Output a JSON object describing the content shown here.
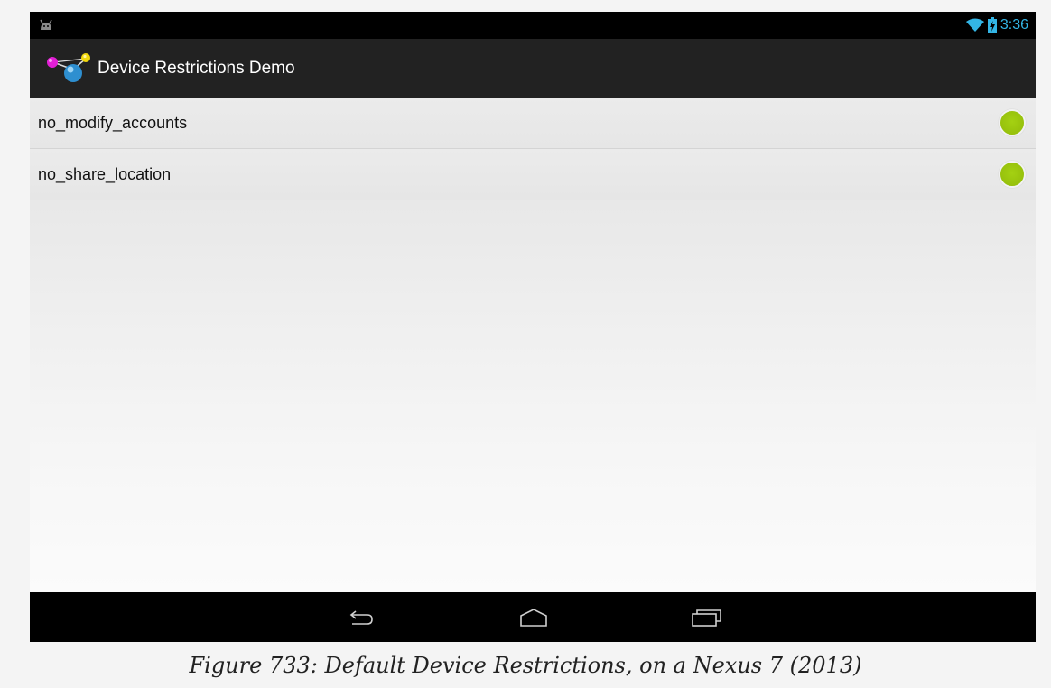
{
  "status_bar": {
    "time": "3:36",
    "icons": [
      "android-notification-icon",
      "wifi-icon",
      "battery-charging-icon"
    ]
  },
  "action_bar": {
    "title": "Device Restrictions Demo",
    "logo_icon": "app-logo-icon"
  },
  "restrictions": [
    {
      "label": "no_modify_accounts",
      "state_color": "#99c30c"
    },
    {
      "label": "no_share_location",
      "state_color": "#99c30c"
    }
  ],
  "nav_bar": {
    "buttons": [
      "back-icon",
      "home-icon",
      "recent-apps-icon"
    ]
  },
  "caption": "Figure 733: Default Device Restrictions, on a Nexus 7 (2013)",
  "colors": {
    "status_accent": "#33b5e5",
    "action_bar_bg": "#222222",
    "indicator_green": "#99c30c"
  }
}
